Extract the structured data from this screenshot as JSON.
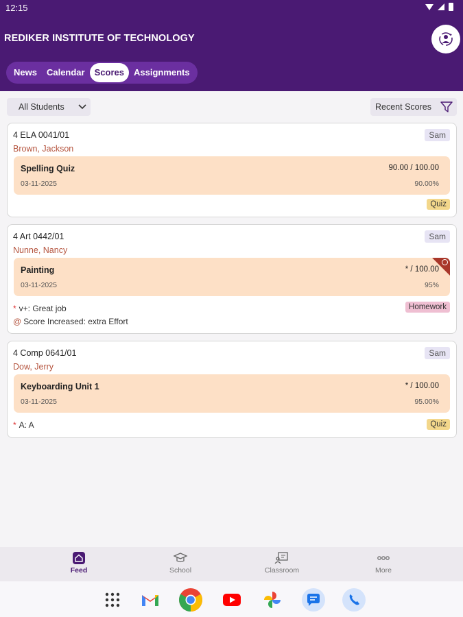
{
  "status_bar": {
    "time": "12:15"
  },
  "header": {
    "title": "REDIKER INSTITUTE OF TECHNOLOGY"
  },
  "tabs": [
    {
      "label": "News",
      "active": false
    },
    {
      "label": "Calendar",
      "active": false
    },
    {
      "label": "Scores",
      "active": true
    },
    {
      "label": "Assignments",
      "active": false
    }
  ],
  "filters": {
    "students": "All Students",
    "scores": "Recent Scores"
  },
  "cards": [
    {
      "course": "4 ELA 0041/01",
      "student": "Brown, Jackson",
      "owner": "Sam",
      "assignment": "Spelling Quiz",
      "score": "90.00 / 100.00",
      "date": "03-11-2025",
      "percent": "90.00%",
      "type": "Quiz",
      "comments": []
    },
    {
      "course": "4 Art 0442/01",
      "student": "Nunne, Nancy",
      "owner": "Sam",
      "assignment": "Painting",
      "score": "* / 100.00",
      "date": "03-11-2025",
      "percent": "95%",
      "type": "Homework",
      "comments": [
        "v+: Great job",
        "Score Increased: extra Effort"
      ]
    },
    {
      "course": "4 Comp 0641/01",
      "student": "Dow, Jerry",
      "owner": "Sam",
      "assignment": "Keyboarding Unit 1",
      "score": "* / 100.00",
      "date": "03-11-2025",
      "percent": "95.00%",
      "type": "Quiz",
      "comments": [
        "A: A"
      ]
    }
  ],
  "bottom_nav": [
    {
      "label": "Feed",
      "icon": "home-icon",
      "active": true
    },
    {
      "label": "School",
      "icon": "graduation-cap-icon",
      "active": false
    },
    {
      "label": "Classroom",
      "icon": "classroom-icon",
      "active": false
    },
    {
      "label": "More",
      "icon": "more-icon",
      "active": false
    }
  ],
  "dock_apps": [
    "app-drawer",
    "gmail",
    "chrome",
    "youtube",
    "photos",
    "messages",
    "phone"
  ],
  "colors": {
    "primary": "#4a1a73",
    "tab_bar": "#6b2fa0",
    "score_box": "#fde0c6",
    "student_name": "#b5543e",
    "quiz_badge": "#f3d78b",
    "homework_badge": "#efbfd2"
  }
}
